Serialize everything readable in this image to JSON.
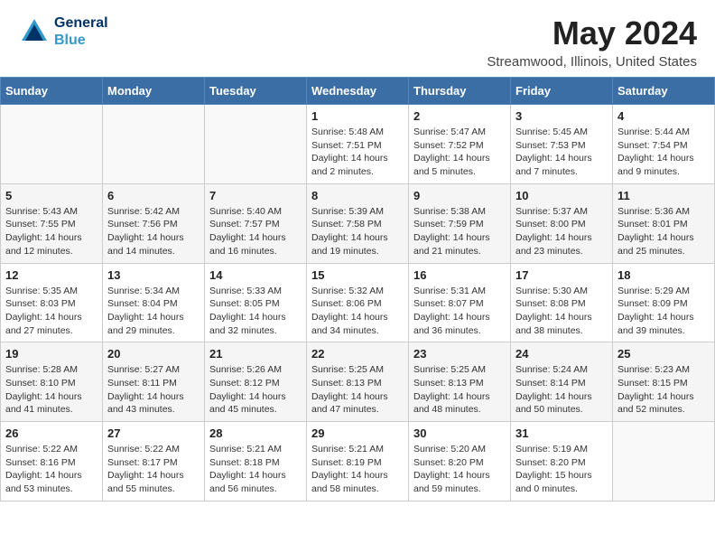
{
  "header": {
    "logo_general": "General",
    "logo_blue": "Blue",
    "month_title": "May 2024",
    "location": "Streamwood, Illinois, United States"
  },
  "days_of_week": [
    "Sunday",
    "Monday",
    "Tuesday",
    "Wednesday",
    "Thursday",
    "Friday",
    "Saturday"
  ],
  "weeks": [
    [
      {
        "day": "",
        "detail": ""
      },
      {
        "day": "",
        "detail": ""
      },
      {
        "day": "",
        "detail": ""
      },
      {
        "day": "1",
        "detail": "Sunrise: 5:48 AM\nSunset: 7:51 PM\nDaylight: 14 hours and 2 minutes."
      },
      {
        "day": "2",
        "detail": "Sunrise: 5:47 AM\nSunset: 7:52 PM\nDaylight: 14 hours and 5 minutes."
      },
      {
        "day": "3",
        "detail": "Sunrise: 5:45 AM\nSunset: 7:53 PM\nDaylight: 14 hours and 7 minutes."
      },
      {
        "day": "4",
        "detail": "Sunrise: 5:44 AM\nSunset: 7:54 PM\nDaylight: 14 hours and 9 minutes."
      }
    ],
    [
      {
        "day": "5",
        "detail": "Sunrise: 5:43 AM\nSunset: 7:55 PM\nDaylight: 14 hours and 12 minutes."
      },
      {
        "day": "6",
        "detail": "Sunrise: 5:42 AM\nSunset: 7:56 PM\nDaylight: 14 hours and 14 minutes."
      },
      {
        "day": "7",
        "detail": "Sunrise: 5:40 AM\nSunset: 7:57 PM\nDaylight: 14 hours and 16 minutes."
      },
      {
        "day": "8",
        "detail": "Sunrise: 5:39 AM\nSunset: 7:58 PM\nDaylight: 14 hours and 19 minutes."
      },
      {
        "day": "9",
        "detail": "Sunrise: 5:38 AM\nSunset: 7:59 PM\nDaylight: 14 hours and 21 minutes."
      },
      {
        "day": "10",
        "detail": "Sunrise: 5:37 AM\nSunset: 8:00 PM\nDaylight: 14 hours and 23 minutes."
      },
      {
        "day": "11",
        "detail": "Sunrise: 5:36 AM\nSunset: 8:01 PM\nDaylight: 14 hours and 25 minutes."
      }
    ],
    [
      {
        "day": "12",
        "detail": "Sunrise: 5:35 AM\nSunset: 8:03 PM\nDaylight: 14 hours and 27 minutes."
      },
      {
        "day": "13",
        "detail": "Sunrise: 5:34 AM\nSunset: 8:04 PM\nDaylight: 14 hours and 29 minutes."
      },
      {
        "day": "14",
        "detail": "Sunrise: 5:33 AM\nSunset: 8:05 PM\nDaylight: 14 hours and 32 minutes."
      },
      {
        "day": "15",
        "detail": "Sunrise: 5:32 AM\nSunset: 8:06 PM\nDaylight: 14 hours and 34 minutes."
      },
      {
        "day": "16",
        "detail": "Sunrise: 5:31 AM\nSunset: 8:07 PM\nDaylight: 14 hours and 36 minutes."
      },
      {
        "day": "17",
        "detail": "Sunrise: 5:30 AM\nSunset: 8:08 PM\nDaylight: 14 hours and 38 minutes."
      },
      {
        "day": "18",
        "detail": "Sunrise: 5:29 AM\nSunset: 8:09 PM\nDaylight: 14 hours and 39 minutes."
      }
    ],
    [
      {
        "day": "19",
        "detail": "Sunrise: 5:28 AM\nSunset: 8:10 PM\nDaylight: 14 hours and 41 minutes."
      },
      {
        "day": "20",
        "detail": "Sunrise: 5:27 AM\nSunset: 8:11 PM\nDaylight: 14 hours and 43 minutes."
      },
      {
        "day": "21",
        "detail": "Sunrise: 5:26 AM\nSunset: 8:12 PM\nDaylight: 14 hours and 45 minutes."
      },
      {
        "day": "22",
        "detail": "Sunrise: 5:25 AM\nSunset: 8:13 PM\nDaylight: 14 hours and 47 minutes."
      },
      {
        "day": "23",
        "detail": "Sunrise: 5:25 AM\nSunset: 8:13 PM\nDaylight: 14 hours and 48 minutes."
      },
      {
        "day": "24",
        "detail": "Sunrise: 5:24 AM\nSunset: 8:14 PM\nDaylight: 14 hours and 50 minutes."
      },
      {
        "day": "25",
        "detail": "Sunrise: 5:23 AM\nSunset: 8:15 PM\nDaylight: 14 hours and 52 minutes."
      }
    ],
    [
      {
        "day": "26",
        "detail": "Sunrise: 5:22 AM\nSunset: 8:16 PM\nDaylight: 14 hours and 53 minutes."
      },
      {
        "day": "27",
        "detail": "Sunrise: 5:22 AM\nSunset: 8:17 PM\nDaylight: 14 hours and 55 minutes."
      },
      {
        "day": "28",
        "detail": "Sunrise: 5:21 AM\nSunset: 8:18 PM\nDaylight: 14 hours and 56 minutes."
      },
      {
        "day": "29",
        "detail": "Sunrise: 5:21 AM\nSunset: 8:19 PM\nDaylight: 14 hours and 58 minutes."
      },
      {
        "day": "30",
        "detail": "Sunrise: 5:20 AM\nSunset: 8:20 PM\nDaylight: 14 hours and 59 minutes."
      },
      {
        "day": "31",
        "detail": "Sunrise: 5:19 AM\nSunset: 8:20 PM\nDaylight: 15 hours and 0 minutes."
      },
      {
        "day": "",
        "detail": ""
      }
    ]
  ]
}
